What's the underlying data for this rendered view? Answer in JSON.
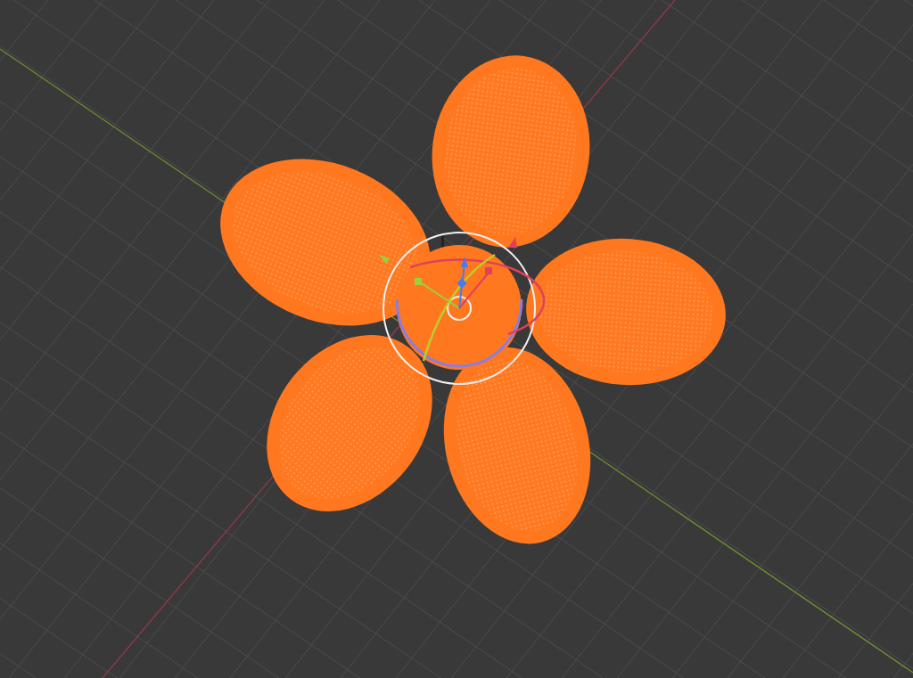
{
  "viewport": {
    "grid": true,
    "axes": true,
    "gizmo": true
  }
}
